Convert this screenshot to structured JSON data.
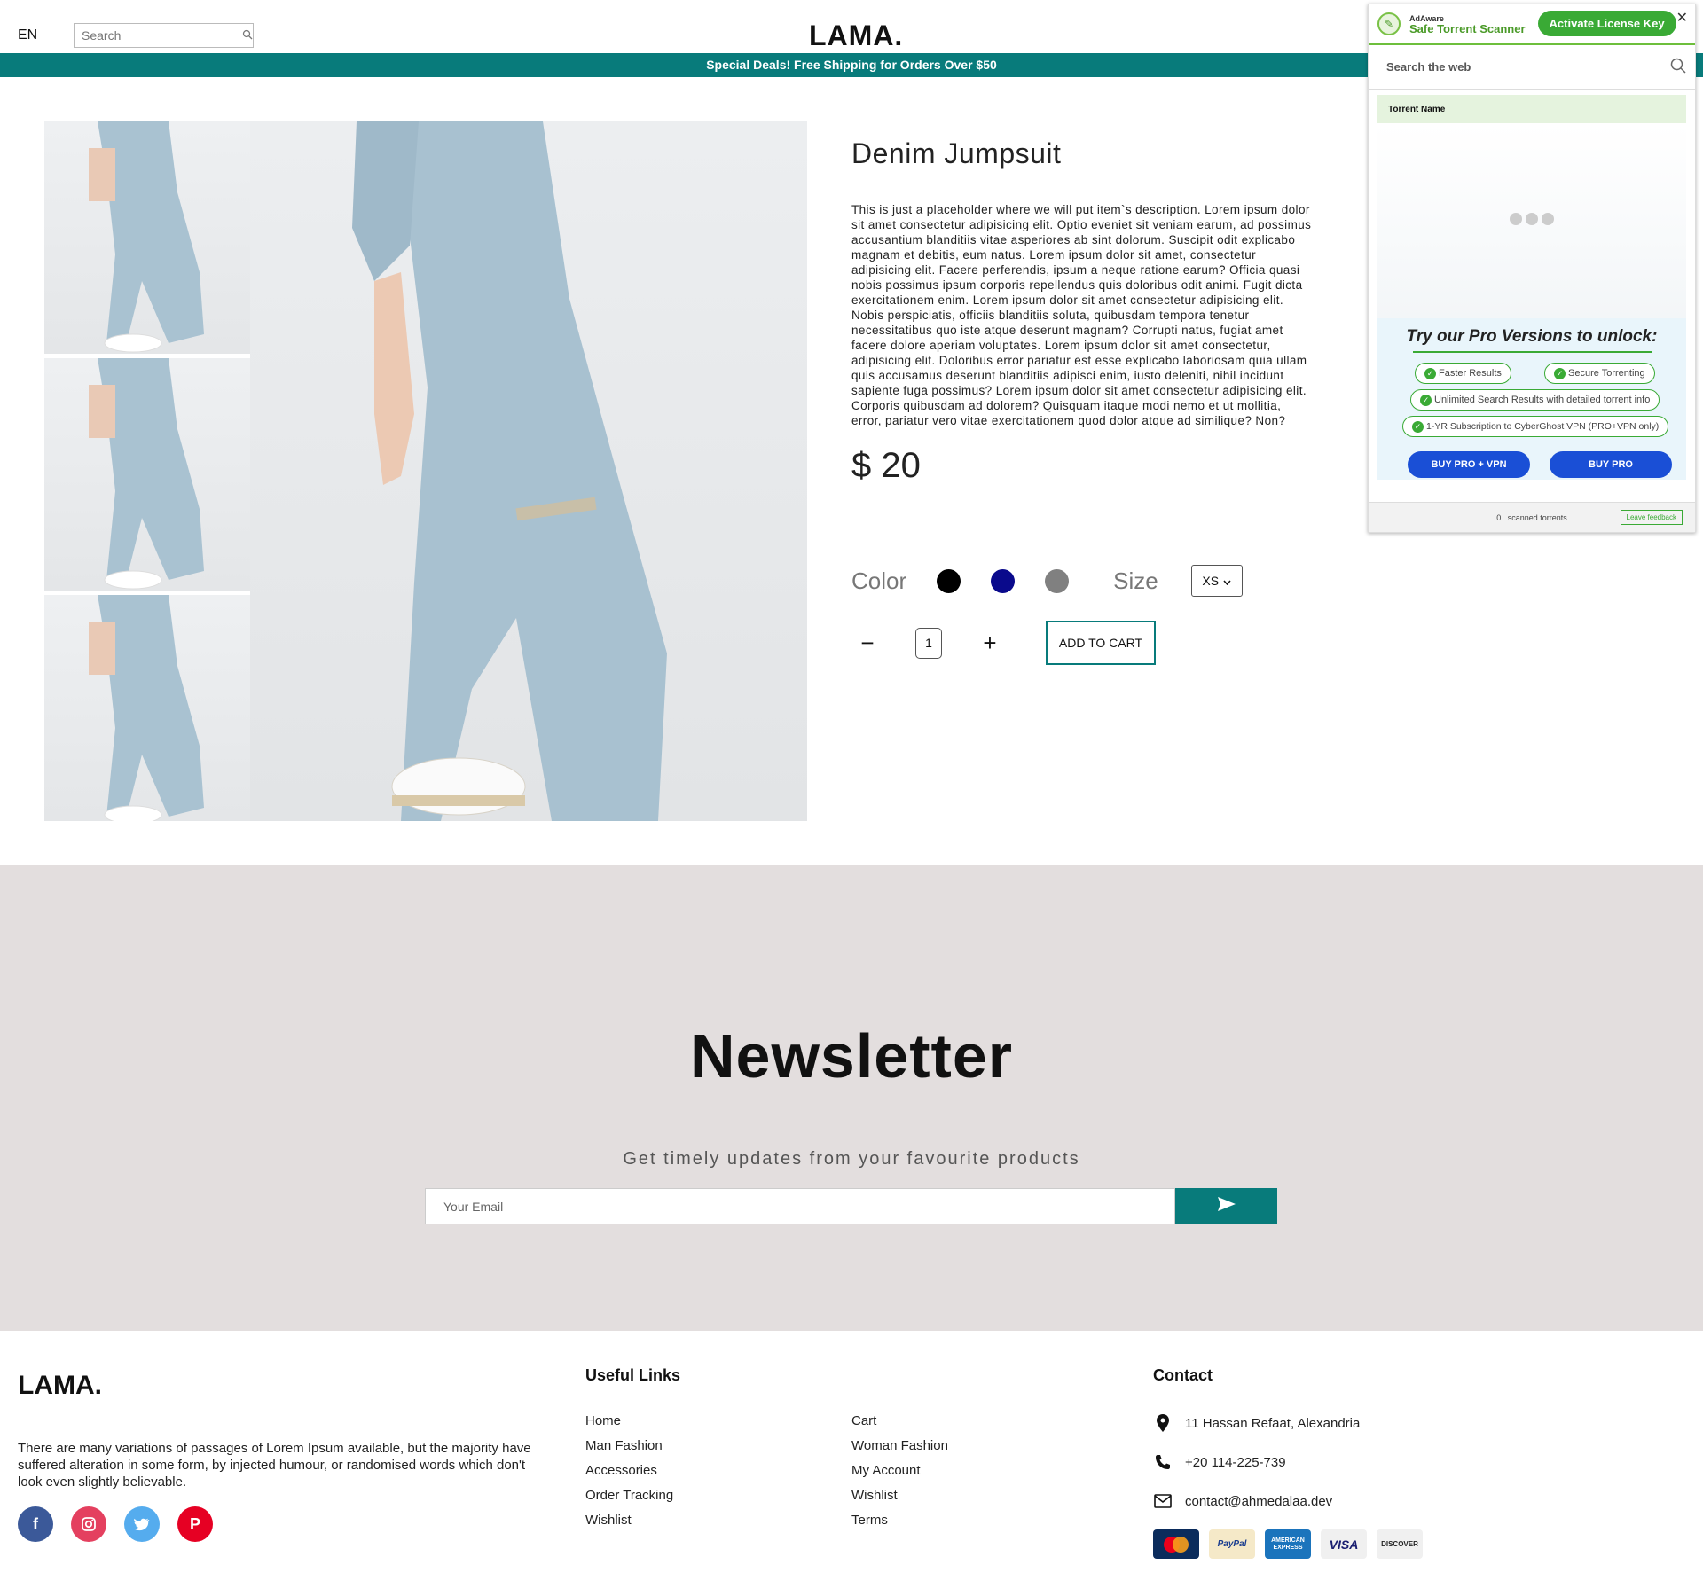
{
  "header": {
    "language": "EN",
    "search_placeholder": "Search",
    "logo": "LAMA.",
    "announcement": "Special Deals! Free Shipping for Orders Over $50"
  },
  "product": {
    "title": "Denim Jumpsuit",
    "description": "This is just a placeholder where we will put item`s description. Lorem ipsum dolor sit amet consectetur adipisicing elit. Optio eveniet sit veniam earum, ad possimus accusantium blanditiis vitae asperiores ab sint dolorum. Suscipit odit explicabo magnam et debitis, eum natus. Lorem ipsum dolor sit amet, consectetur adipisicing elit. Facere perferendis, ipsum a neque ratione earum? Officia quasi nobis possimus ipsum corporis repellendus quis doloribus odit animi. Fugit dicta exercitationem enim. Lorem ipsum dolor sit amet consectetur adipisicing elit. Nobis perspiciatis, officiis blanditiis soluta, quibusdam tempora tenetur necessitatibus quo iste atque deserunt magnam? Corrupti natus, fugiat amet facere dolore aperiam voluptates. Lorem ipsum dolor sit amet consectetur, adipisicing elit. Doloribus error pariatur est esse explicabo laboriosam quia ullam quis accusamus deserunt blanditiis adipisci enim, iusto deleniti, nihil incidunt sapiente fuga possimus? Lorem ipsum dolor sit amet consectetur adipisicing elit. Corporis quibusdam ad dolorem? Quisquam itaque modi nemo et ut mollitia, error, pariatur vero vitae exercitationem quod dolor atque ad similique? Non?",
    "price": "$ 20",
    "color_label": "Color",
    "colors": [
      "#000000",
      "#0a0a8c",
      "#808080"
    ],
    "size_label": "Size",
    "size_value": "XS",
    "quantity": "1",
    "minus": "−",
    "plus": "+",
    "add_to_cart": "ADD TO CART"
  },
  "newsletter": {
    "title": "Newsletter",
    "subtitle": "Get timely updates from your favourite products",
    "email_placeholder": "Your Email"
  },
  "footer": {
    "logo": "LAMA.",
    "about": "There are many variations of passages of Lorem Ipsum available, but the majority have suffered alteration in some form, by injected humour, or randomised words which don't look even slightly believable.",
    "useful_links_title": "Useful Links",
    "links_col1": [
      "Home",
      "Man Fashion",
      "Accessories",
      "Order Tracking",
      "Wishlist"
    ],
    "links_col2": [
      "Cart",
      "Woman Fashion",
      "My Account",
      "Wishlist",
      "Terms"
    ],
    "contact_title": "Contact",
    "address": "11 Hassan Refaat, Alexandria",
    "phone": "+20 114-225-739",
    "email": "contact@ahmedalaa.dev",
    "payments": [
      "MasterCard",
      "PayPal",
      "AMERICAN EXPRESS",
      "VISA",
      "DISCOVER"
    ]
  },
  "adaware": {
    "brand_small": "AdAware",
    "brand_name": "Safe Torrent Scanner",
    "activate": "Activate License Key",
    "search_placeholder": "Search the web",
    "table_header": "Torrent Name",
    "promo_title": "Try our Pro Versions to unlock:",
    "features": [
      "Faster Results",
      "Secure Torrenting",
      "Unlimited Search Results with detailed torrent info",
      "1-YR Subscription to CyberGhost VPN (PRO+VPN only)"
    ],
    "buy_pro_vpn": "BUY PRO + VPN",
    "buy_pro": "BUY PRO",
    "scanned_count": "0",
    "scanned_label": "scanned torrents",
    "feedback": "Leave feedback"
  }
}
